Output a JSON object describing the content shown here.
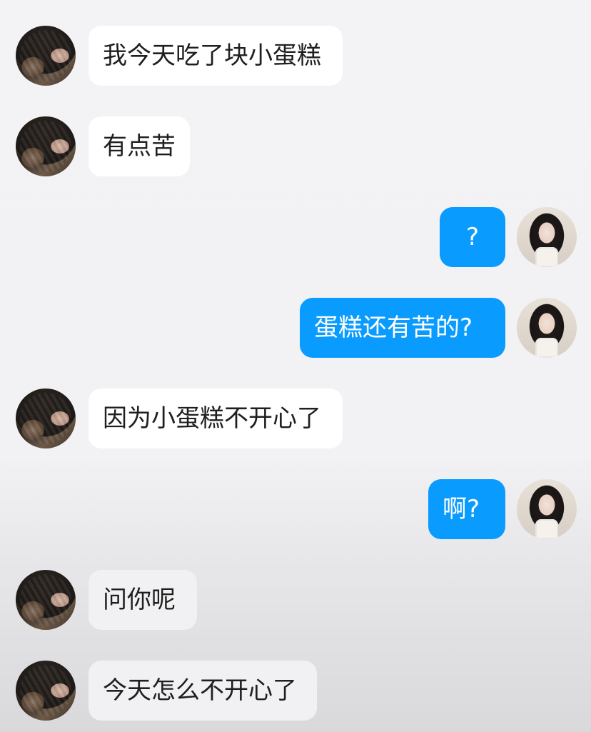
{
  "messages": [
    {
      "side": "left",
      "text": "我今天吃了块小蛋糕"
    },
    {
      "side": "left",
      "text": "有点苦"
    },
    {
      "side": "right",
      "text": "?"
    },
    {
      "side": "right",
      "text": "蛋糕还有苦的?"
    },
    {
      "side": "left",
      "text": "因为小蛋糕不开心了"
    },
    {
      "side": "right",
      "text": "啊?"
    },
    {
      "side": "left",
      "text": "问你呢"
    },
    {
      "side": "left",
      "text": "今天怎么不开心了"
    }
  ],
  "colors": {
    "incoming_bubble": "#ffffff",
    "outgoing_bubble": "#0a9bff",
    "incoming_text": "#1f1f1f",
    "outgoing_text": "#ffffff",
    "background": "#f3f3f5"
  },
  "avatars": {
    "incoming": "cat-photo-avatar",
    "outgoing": "girl-photo-avatar"
  }
}
